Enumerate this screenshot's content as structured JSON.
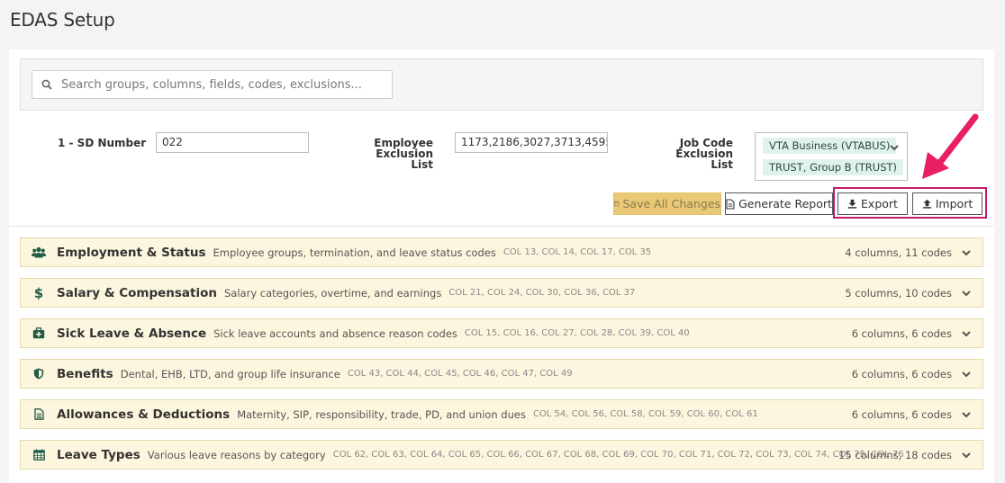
{
  "page": {
    "title": "EDAS Setup"
  },
  "search": {
    "placeholder": "Search groups, columns, fields, codes, exclusions..."
  },
  "fields": {
    "sd_number": {
      "label": "1 - SD Number",
      "value": "022"
    },
    "employee_exclusion": {
      "label_line1": "Employee Exclusion",
      "label_line2": "List",
      "value": "1173,2186,3027,3713,4595,4"
    },
    "job_code_exclusion": {
      "label_line1": "Job Code Exclusion",
      "label_line2": "List",
      "tags": [
        "VTA Business (VTABUS)",
        "TRUST, Group B (TRUST)"
      ]
    }
  },
  "toolbar": {
    "save_label": "Save All Changes",
    "report_label": "Generate Report",
    "export_label": "Export",
    "import_label": "Import"
  },
  "groups": [
    {
      "title": "Employment & Status",
      "description": "Employee groups, termination, and leave status codes",
      "columns": "COL 13, COL 14, COL 17, COL 35",
      "count": "4 columns, 11 codes",
      "icon": "users-icon"
    },
    {
      "title": "Salary & Compensation",
      "description": "Salary categories, overtime, and earnings",
      "columns": "COL 21, COL 24, COL 30, COL 36, COL 37",
      "count": "5 columns, 10 codes",
      "icon": "dollar-icon"
    },
    {
      "title": "Sick Leave & Absence",
      "description": "Sick leave accounts and absence reason codes",
      "columns": "COL 15, COL 16, COL 27, COL 28, COL 39, COL 40",
      "count": "6 columns, 6 codes",
      "icon": "medkit-icon"
    },
    {
      "title": "Benefits",
      "description": "Dental, EHB, LTD, and group life insurance",
      "columns": "COL 43, COL 44, COL 45, COL 46, COL 47, COL 49",
      "count": "6 columns, 6 codes",
      "icon": "shield-icon"
    },
    {
      "title": "Allowances & Deductions",
      "description": "Maternity, SIP, responsibility, trade, PD, and union dues",
      "columns": "COL 54, COL 56, COL 58, COL 59, COL 60, COL 61",
      "count": "6 columns, 6 codes",
      "icon": "document-icon"
    },
    {
      "title": "Leave Types",
      "description": "Various leave reasons by category",
      "columns": "COL 62, COL 63, COL 64, COL 65, COL 66, COL 67, COL 68, COL 69, COL 70, COL 71, COL 72, COL 73, COL 74, COL 75, COL 76",
      "count": "15 columns, 18 codes",
      "icon": "calendar-icon"
    }
  ],
  "colors": {
    "accent": "#1f5c45",
    "highlight": "#c2186b",
    "group_bg": "#fdf6df",
    "save_bg": "#e9c976"
  }
}
